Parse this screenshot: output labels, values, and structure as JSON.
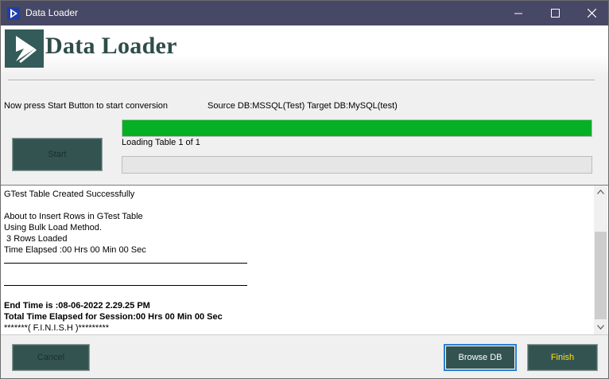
{
  "window": {
    "title": "Data Loader",
    "icons": {
      "app": "play-triangle-icon",
      "minimize": "minimize-icon",
      "maximize": "maximize-icon",
      "close": "close-icon"
    }
  },
  "header": {
    "logo_icon": "data-loader-logo-icon",
    "title": "Data Loader"
  },
  "status": {
    "message": "Now press Start Button to start conversion",
    "db_info": "Source DB:MSSQL(Test) Target DB:MySQL(test)"
  },
  "progress": {
    "top_fraction": 1.0,
    "label": "Loading Table 1 of 1",
    "bottom_fraction": 0.0,
    "fill_color": "#06b025"
  },
  "buttons": {
    "start": "Start",
    "cancel": "Cancel",
    "browse": "Browse DB",
    "finish": "Finish"
  },
  "log": {
    "lines": [
      {
        "text": "GTest Table Created Successfully",
        "style": "normal"
      },
      {
        "text": "",
        "style": "normal"
      },
      {
        "text": "About to Insert Rows in GTest Table",
        "style": "normal"
      },
      {
        "text": "Using Bulk Load Method.",
        "style": "normal"
      },
      {
        "text": " 3 Rows Loaded",
        "style": "normal"
      },
      {
        "text": "Time Elapsed :00 Hrs 00 Min 00 Sec",
        "style": "normal"
      },
      {
        "text": "",
        "style": "rule"
      },
      {
        "text": "",
        "style": "normal"
      },
      {
        "text": "",
        "style": "rule"
      },
      {
        "text": "",
        "style": "normal"
      },
      {
        "text": "End Time is :08-06-2022 2.29.25 PM",
        "style": "bold"
      },
      {
        "text": "Total Time Elapsed for Session:00 Hrs 00 Min 00 Sec",
        "style": "bold"
      },
      {
        "text": "*******( F.I.N.I.S.H )*********",
        "style": "normal"
      }
    ]
  },
  "colors": {
    "titlebar": "#474766",
    "button_bg": "#335351",
    "finish_text": "#ffe100",
    "progress": "#06b025"
  }
}
